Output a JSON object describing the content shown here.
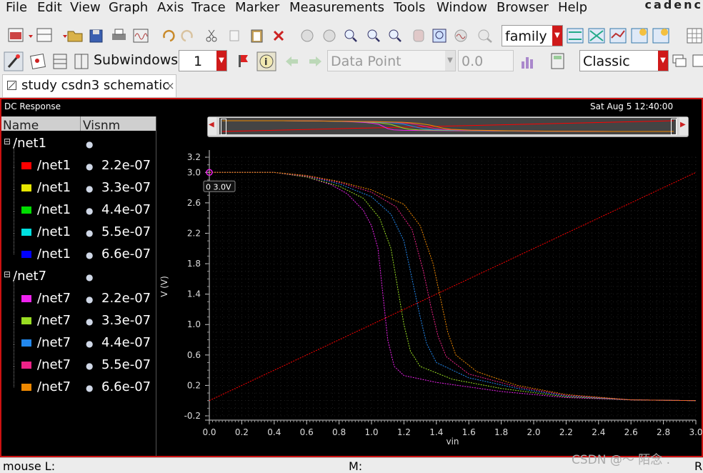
{
  "menu": [
    "File",
    "Edit",
    "View",
    "Graph",
    "Axis",
    "Trace",
    "Marker",
    "Measurements",
    "Tools",
    "Window",
    "Browser",
    "Help"
  ],
  "brand": "cadenc",
  "toolbar1": {
    "family_value": "family"
  },
  "toolbar2": {
    "subwindows_label": "Subwindows:",
    "subwindows_value": "1",
    "data_point_placeholder": "Data Point",
    "data_point_value": "0.0",
    "style_value": "Classic"
  },
  "tab": {
    "title": "study csdn3 schematic",
    "close": "×"
  },
  "graph": {
    "title": "DC Response",
    "timestamp": "Sat Aug 5 12:40:00",
    "legend_headers": {
      "name": "Name",
      "vis": "Vis",
      "nm": "nm"
    },
    "marker_label": "0 3.0V"
  },
  "legend": [
    {
      "group": "/net1",
      "type": "group"
    },
    {
      "name": "/net1",
      "value": "2.2e-07",
      "color": "#ff0000"
    },
    {
      "name": "/net1",
      "value": "3.3e-07",
      "color": "#e6e600"
    },
    {
      "name": "/net1",
      "value": "4.4e-07",
      "color": "#00dd00"
    },
    {
      "name": "/net1",
      "value": "5.5e-07",
      "color": "#00e0e0"
    },
    {
      "name": "/net1",
      "value": "6.6e-07",
      "color": "#0000ff"
    },
    {
      "group": "/net7",
      "type": "group"
    },
    {
      "name": "/net7",
      "value": "2.2e-07",
      "color": "#ee22ee"
    },
    {
      "name": "/net7",
      "value": "3.3e-07",
      "color": "#99dd22"
    },
    {
      "name": "/net7",
      "value": "4.4e-07",
      "color": "#2288ee"
    },
    {
      "name": "/net7",
      "value": "5.5e-07",
      "color": "#ee2288"
    },
    {
      "name": "/net7",
      "value": "6.6e-07",
      "color": "#ee8800"
    }
  ],
  "chart_data": {
    "type": "line",
    "xlabel": "vin",
    "ylabel": "V (V)",
    "xlim": [
      0.0,
      3.0
    ],
    "ylim": [
      -0.2,
      3.2
    ],
    "x_ticks": [
      "0.0",
      "0.2",
      "0.4",
      "0.6",
      "0.8",
      "1.0",
      "1.2",
      "1.4",
      "1.6",
      "1.8",
      "2.0",
      "2.2",
      "2.4",
      "2.6",
      "2.8",
      "3.0"
    ],
    "y_ticks": [
      "3.2",
      "3.0",
      "2.6",
      "2.2",
      "1.8",
      "1.4",
      "1.0",
      "0.6",
      "0.2",
      "-0.2"
    ],
    "grid": true,
    "series": [
      {
        "name": "/net1 2.2e-07",
        "color": "#ff0000",
        "x": [
          0.0,
          3.0
        ],
        "y": [
          0.0,
          3.0
        ]
      },
      {
        "name": "/net7 2.2e-07",
        "color": "#ee22ee",
        "x": [
          0.0,
          0.4,
          0.6,
          0.75,
          0.85,
          0.95,
          1.0,
          1.04,
          1.08,
          1.1,
          1.14,
          1.2,
          1.4,
          1.8,
          2.2,
          2.6,
          3.0
        ],
        "y": [
          3.0,
          3.0,
          2.94,
          2.84,
          2.72,
          2.5,
          2.3,
          2.0,
          1.2,
          0.8,
          0.45,
          0.33,
          0.24,
          0.12,
          0.04,
          0.01,
          0.0
        ]
      },
      {
        "name": "/net7 3.3e-07",
        "color": "#99dd22",
        "x": [
          0.0,
          0.4,
          0.6,
          0.8,
          0.95,
          1.05,
          1.12,
          1.16,
          1.2,
          1.24,
          1.3,
          1.5,
          1.8,
          2.2,
          2.6,
          3.0
        ],
        "y": [
          3.0,
          3.0,
          2.94,
          2.82,
          2.66,
          2.4,
          2.0,
          1.5,
          1.0,
          0.65,
          0.45,
          0.28,
          0.16,
          0.05,
          0.01,
          0.0
        ]
      },
      {
        "name": "/net7 4.4e-07",
        "color": "#2288ee",
        "x": [
          0.0,
          0.4,
          0.6,
          0.8,
          1.0,
          1.12,
          1.2,
          1.25,
          1.3,
          1.34,
          1.4,
          1.6,
          1.9,
          2.2,
          2.6,
          3.0
        ],
        "y": [
          3.0,
          3.0,
          2.95,
          2.85,
          2.68,
          2.45,
          2.1,
          1.6,
          1.1,
          0.75,
          0.5,
          0.3,
          0.16,
          0.06,
          0.01,
          0.0
        ]
      },
      {
        "name": "/net7 5.5e-07",
        "color": "#ee2288",
        "x": [
          0.0,
          0.4,
          0.6,
          0.8,
          1.0,
          1.15,
          1.25,
          1.32,
          1.37,
          1.41,
          1.46,
          1.6,
          1.9,
          2.2,
          2.6,
          3.0
        ],
        "y": [
          3.0,
          3.0,
          2.95,
          2.87,
          2.74,
          2.55,
          2.25,
          1.7,
          1.2,
          0.85,
          0.58,
          0.35,
          0.18,
          0.07,
          0.01,
          0.0
        ]
      },
      {
        "name": "/net7 6.6e-07",
        "color": "#ee8800",
        "x": [
          0.0,
          0.4,
          0.6,
          0.8,
          1.0,
          1.2,
          1.3,
          1.38,
          1.43,
          1.47,
          1.52,
          1.65,
          1.9,
          2.2,
          2.6,
          3.0
        ],
        "y": [
          3.0,
          3.0,
          2.96,
          2.88,
          2.77,
          2.58,
          2.3,
          1.8,
          1.3,
          0.9,
          0.6,
          0.38,
          0.2,
          0.08,
          0.01,
          0.0
        ]
      }
    ]
  },
  "status": {
    "mouse": "mouse L:",
    "middle": "M:",
    "right": "R",
    "watermark": "CSDN @〜 陌念 ."
  }
}
